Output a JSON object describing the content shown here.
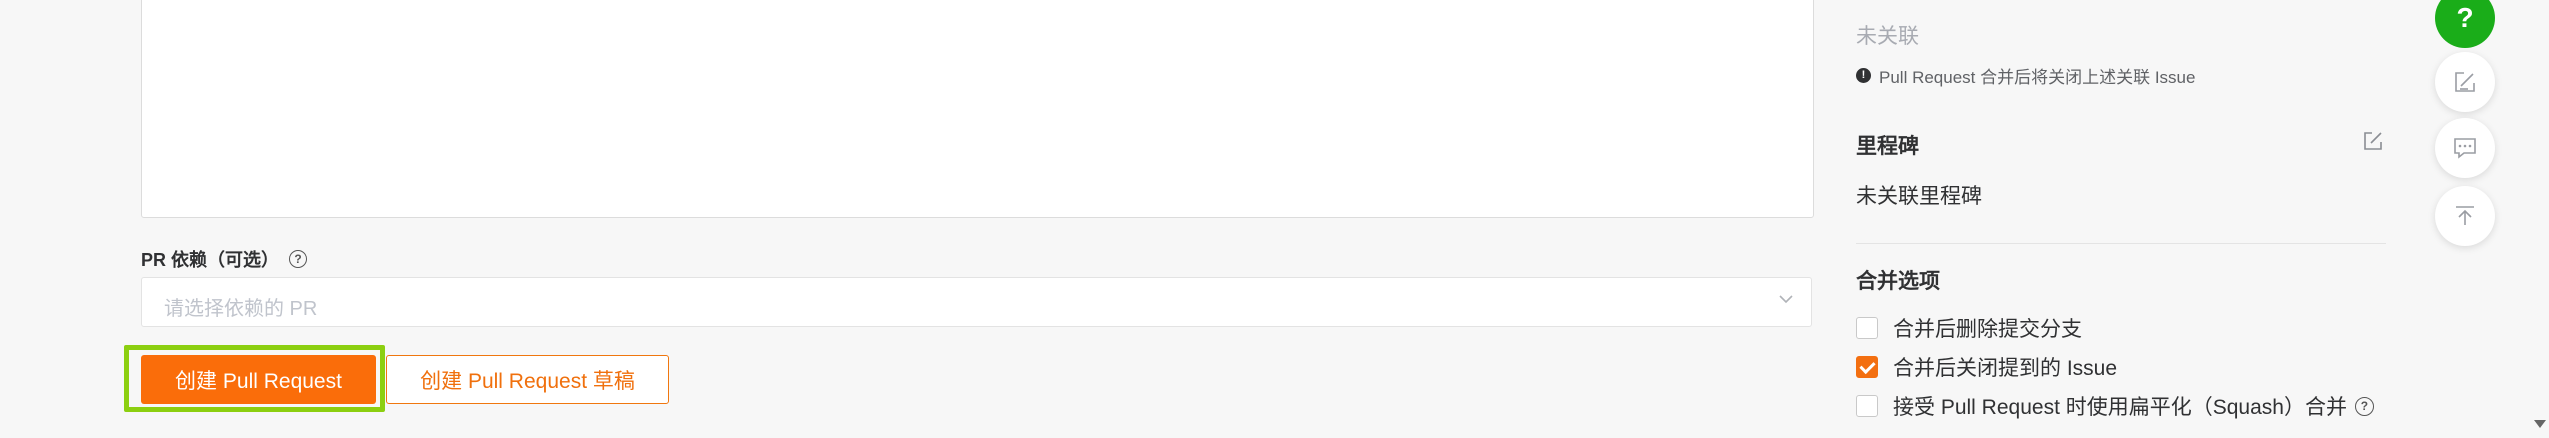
{
  "form": {
    "pr_dependency_label": "PR 依赖（可选）",
    "pr_dependency_placeholder": "请选择依赖的 PR",
    "create_button": "创建 Pull Request",
    "create_draft_button": "创建 Pull Request 草稿"
  },
  "sidebar": {
    "issues": {
      "status": "未关联",
      "note": "Pull Request 合并后将关闭上述关联 Issue"
    },
    "milestone": {
      "title": "里程碑",
      "value": "未关联里程碑"
    },
    "merge_options": {
      "title": "合并选项",
      "items": [
        {
          "label": "合并后删除提交分支",
          "checked": false
        },
        {
          "label": "合并后关闭提到的 Issue",
          "checked": true
        },
        {
          "label": "接受 Pull Request 时使用扁平化（Squash）合并",
          "checked": false
        }
      ]
    }
  },
  "floating": {
    "help_label": "?"
  },
  "colors": {
    "primary": "#fa6d0a",
    "highlight": "#8ccf10",
    "fab_green": "#1aad19"
  }
}
